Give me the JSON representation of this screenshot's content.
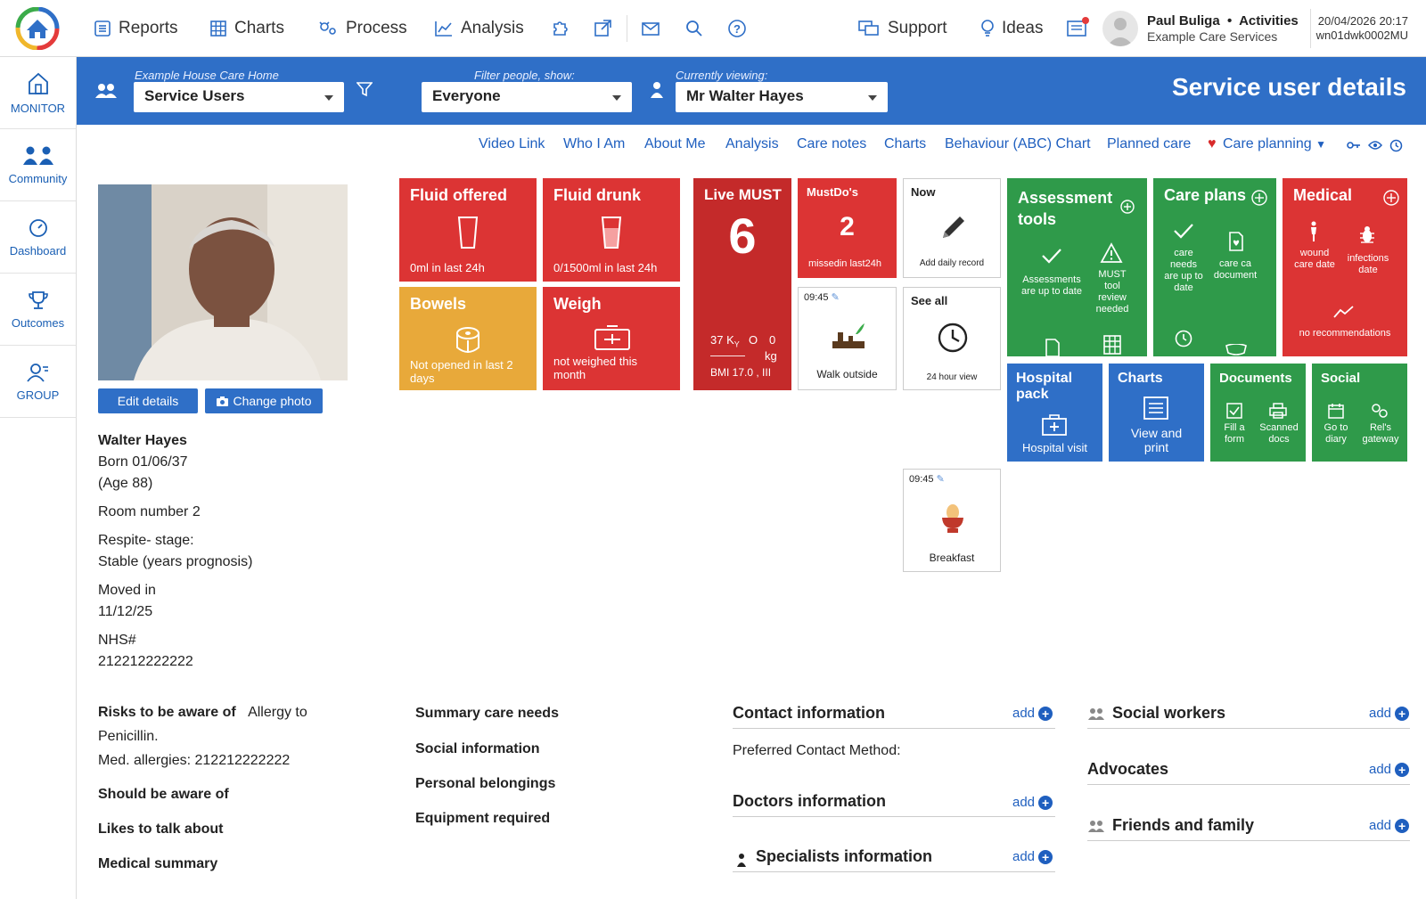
{
  "topbar": {
    "nav": [
      {
        "label": "Reports",
        "icon": "reports-icon"
      },
      {
        "label": "Charts",
        "icon": "charts-grid-icon"
      },
      {
        "label": "Process",
        "icon": "process-icon"
      },
      {
        "label": "Analysis",
        "icon": "analysis-icon"
      }
    ],
    "support_label": "Support",
    "ideas_label": "Ideas",
    "user_name": "Paul Buliga",
    "user_role": "Activities",
    "user_org": "Example Care Services",
    "datetime": "20/04/2026 20:17",
    "device_id": "wn01dwk0002MU"
  },
  "sidebar": [
    {
      "label": "MONITOR",
      "icon": "monitor-home-icon"
    },
    {
      "label": "Community",
      "icon": "community-icon"
    },
    {
      "label": "Dashboard",
      "icon": "dashboard-icon"
    },
    {
      "label": "Outcomes",
      "icon": "trophy-icon"
    },
    {
      "label": "GROUP",
      "icon": "group-icon"
    }
  ],
  "header": {
    "home_caption": "Example House Care Home",
    "home_value": "Service Users",
    "filter_caption": "Filter people, show:",
    "filter_value": "Everyone",
    "viewing_caption": "Currently viewing:",
    "viewing_value": "Mr Walter Hayes",
    "title": "Service user details"
  },
  "subnav": [
    "Video Link",
    "Who I Am",
    "About Me",
    "Analysis",
    "Care notes",
    "Charts",
    "Behaviour (ABC) Chart",
    "Planned care",
    "Care planning"
  ],
  "profile": {
    "edit_label": "Edit details",
    "photo_label": "Change photo",
    "name": "Walter Hayes",
    "born": "Born 01/06/37",
    "age": "(Age 88)",
    "room": "Room number 2",
    "respite": "Respite- stage:",
    "prognosis": "Stable (years prognosis)",
    "moved_label": "Moved in",
    "moved_date": "11/12/25",
    "nhs_label": "NHS#",
    "nhs_value": "212212222222"
  },
  "tiles": {
    "fluid_offered": {
      "title": "Fluid offered",
      "foot": "0ml in last 24h"
    },
    "fluid_drunk": {
      "title": "Fluid drunk",
      "foot": "0/1500ml in last 24h"
    },
    "live_must": {
      "title": "Live MUST",
      "score": "6",
      "ky": "37 K",
      "ky_sub": "Y",
      "o_label": "O",
      "zero": "0",
      "kg": "kg",
      "dashes": "———",
      "bmi": "BMI 17.0 , III"
    },
    "mustdos": {
      "title": "MustDo's",
      "count": "2",
      "foot": "missedin last24h"
    },
    "now": {
      "title": "Now",
      "foot": "Add daily record"
    },
    "bowels": {
      "title": "Bowels",
      "foot": "Not opened in last 2 days"
    },
    "weigh": {
      "title": "Weigh",
      "foot": "not weighed this month"
    },
    "walk": {
      "time": "09:45",
      "label": "Walk outside"
    },
    "see_all": {
      "title": "See all",
      "foot": "24 hour view"
    },
    "breakfast": {
      "time": "09:45",
      "label": "Breakfast"
    },
    "assessment": {
      "title1": "Assessment",
      "title2": "tools",
      "item1": "Assessments are up to date",
      "item2": "MUST tool review needed"
    },
    "care_plans": {
      "title": "Care plans",
      "item1": "care needs are up to date",
      "item2": "care ca document"
    },
    "medical": {
      "title": "Medical",
      "item1": "wound care date",
      "item2": "infections date",
      "item3": "no recommendations"
    },
    "hospital": {
      "title1": "Hospital",
      "title2": "pack",
      "foot": "Hospital visit"
    },
    "charts": {
      "title": "Charts",
      "foot": "View and print"
    },
    "documents": {
      "title": "Documents",
      "item1": "Fill a form",
      "item2": "Scanned docs"
    },
    "social": {
      "title": "Social",
      "item1": "Go to diary",
      "item2": "Rel's gateway"
    }
  },
  "risks": {
    "risk_label": "Risks to be aware of",
    "risk_text1": "Allergy to",
    "risk_text2": "Penicillin.",
    "med_allergies": "Med. allergies: 212212222222",
    "should": "Should be aware of",
    "likes": "Likes to talk about",
    "medical_summary": "Medical summary"
  },
  "summary": [
    "Summary care needs",
    "Social information",
    "Personal belongings",
    "Equipment required"
  ],
  "contact": {
    "contact_title": "Contact information",
    "preferred": "Preferred Contact Method:",
    "doctors_title": "Doctors information",
    "specialists_title": "Specialists information",
    "add_label": "add"
  },
  "right": {
    "social_workers": "Social workers",
    "advocates": "Advocates",
    "friends": "Friends and family",
    "add_label": "add"
  },
  "colors": {
    "brand_blue": "#2f6fc7",
    "tile_red": "#dc3434",
    "tile_green": "#2f9a4a",
    "tile_orange": "#e8a93a",
    "link_blue": "#1f5fbf"
  }
}
